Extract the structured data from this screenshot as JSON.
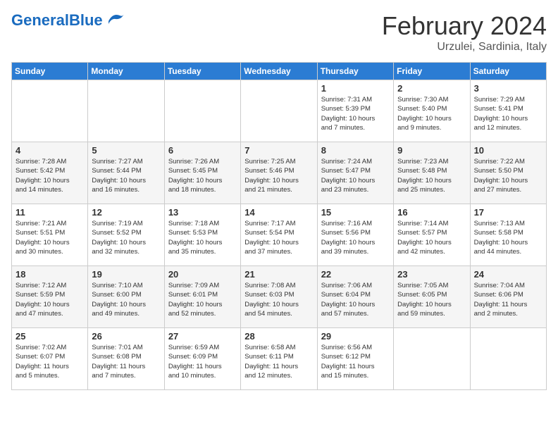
{
  "header": {
    "logo_general": "General",
    "logo_blue": "Blue",
    "month_title": "February 2024",
    "location": "Urzulei, Sardinia, Italy"
  },
  "days_of_week": [
    "Sunday",
    "Monday",
    "Tuesday",
    "Wednesday",
    "Thursday",
    "Friday",
    "Saturday"
  ],
  "weeks": [
    [
      {
        "day": "",
        "info": ""
      },
      {
        "day": "",
        "info": ""
      },
      {
        "day": "",
        "info": ""
      },
      {
        "day": "",
        "info": ""
      },
      {
        "day": "1",
        "info": "Sunrise: 7:31 AM\nSunset: 5:39 PM\nDaylight: 10 hours\nand 7 minutes."
      },
      {
        "day": "2",
        "info": "Sunrise: 7:30 AM\nSunset: 5:40 PM\nDaylight: 10 hours\nand 9 minutes."
      },
      {
        "day": "3",
        "info": "Sunrise: 7:29 AM\nSunset: 5:41 PM\nDaylight: 10 hours\nand 12 minutes."
      }
    ],
    [
      {
        "day": "4",
        "info": "Sunrise: 7:28 AM\nSunset: 5:42 PM\nDaylight: 10 hours\nand 14 minutes."
      },
      {
        "day": "5",
        "info": "Sunrise: 7:27 AM\nSunset: 5:44 PM\nDaylight: 10 hours\nand 16 minutes."
      },
      {
        "day": "6",
        "info": "Sunrise: 7:26 AM\nSunset: 5:45 PM\nDaylight: 10 hours\nand 18 minutes."
      },
      {
        "day": "7",
        "info": "Sunrise: 7:25 AM\nSunset: 5:46 PM\nDaylight: 10 hours\nand 21 minutes."
      },
      {
        "day": "8",
        "info": "Sunrise: 7:24 AM\nSunset: 5:47 PM\nDaylight: 10 hours\nand 23 minutes."
      },
      {
        "day": "9",
        "info": "Sunrise: 7:23 AM\nSunset: 5:48 PM\nDaylight: 10 hours\nand 25 minutes."
      },
      {
        "day": "10",
        "info": "Sunrise: 7:22 AM\nSunset: 5:50 PM\nDaylight: 10 hours\nand 27 minutes."
      }
    ],
    [
      {
        "day": "11",
        "info": "Sunrise: 7:21 AM\nSunset: 5:51 PM\nDaylight: 10 hours\nand 30 minutes."
      },
      {
        "day": "12",
        "info": "Sunrise: 7:19 AM\nSunset: 5:52 PM\nDaylight: 10 hours\nand 32 minutes."
      },
      {
        "day": "13",
        "info": "Sunrise: 7:18 AM\nSunset: 5:53 PM\nDaylight: 10 hours\nand 35 minutes."
      },
      {
        "day": "14",
        "info": "Sunrise: 7:17 AM\nSunset: 5:54 PM\nDaylight: 10 hours\nand 37 minutes."
      },
      {
        "day": "15",
        "info": "Sunrise: 7:16 AM\nSunset: 5:56 PM\nDaylight: 10 hours\nand 39 minutes."
      },
      {
        "day": "16",
        "info": "Sunrise: 7:14 AM\nSunset: 5:57 PM\nDaylight: 10 hours\nand 42 minutes."
      },
      {
        "day": "17",
        "info": "Sunrise: 7:13 AM\nSunset: 5:58 PM\nDaylight: 10 hours\nand 44 minutes."
      }
    ],
    [
      {
        "day": "18",
        "info": "Sunrise: 7:12 AM\nSunset: 5:59 PM\nDaylight: 10 hours\nand 47 minutes."
      },
      {
        "day": "19",
        "info": "Sunrise: 7:10 AM\nSunset: 6:00 PM\nDaylight: 10 hours\nand 49 minutes."
      },
      {
        "day": "20",
        "info": "Sunrise: 7:09 AM\nSunset: 6:01 PM\nDaylight: 10 hours\nand 52 minutes."
      },
      {
        "day": "21",
        "info": "Sunrise: 7:08 AM\nSunset: 6:03 PM\nDaylight: 10 hours\nand 54 minutes."
      },
      {
        "day": "22",
        "info": "Sunrise: 7:06 AM\nSunset: 6:04 PM\nDaylight: 10 hours\nand 57 minutes."
      },
      {
        "day": "23",
        "info": "Sunrise: 7:05 AM\nSunset: 6:05 PM\nDaylight: 10 hours\nand 59 minutes."
      },
      {
        "day": "24",
        "info": "Sunrise: 7:04 AM\nSunset: 6:06 PM\nDaylight: 11 hours\nand 2 minutes."
      }
    ],
    [
      {
        "day": "25",
        "info": "Sunrise: 7:02 AM\nSunset: 6:07 PM\nDaylight: 11 hours\nand 5 minutes."
      },
      {
        "day": "26",
        "info": "Sunrise: 7:01 AM\nSunset: 6:08 PM\nDaylight: 11 hours\nand 7 minutes."
      },
      {
        "day": "27",
        "info": "Sunrise: 6:59 AM\nSunset: 6:09 PM\nDaylight: 11 hours\nand 10 minutes."
      },
      {
        "day": "28",
        "info": "Sunrise: 6:58 AM\nSunset: 6:11 PM\nDaylight: 11 hours\nand 12 minutes."
      },
      {
        "day": "29",
        "info": "Sunrise: 6:56 AM\nSunset: 6:12 PM\nDaylight: 11 hours\nand 15 minutes."
      },
      {
        "day": "",
        "info": ""
      },
      {
        "day": "",
        "info": ""
      }
    ]
  ]
}
